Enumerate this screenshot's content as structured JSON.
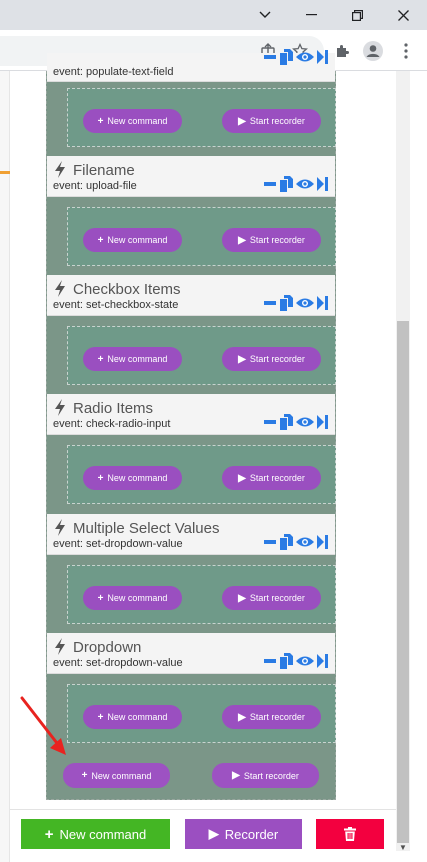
{
  "window": {
    "controls": [
      "chevron-down",
      "minimize",
      "restore",
      "close"
    ]
  },
  "browser_toolbar": {
    "icons": [
      "share-icon",
      "star-icon",
      "extensions-icon",
      "profile-icon",
      "menu-icon"
    ]
  },
  "partial_event": {
    "event": "event: populate-text-field"
  },
  "events": [
    {
      "name": "Filename",
      "event": "event: upload-file"
    },
    {
      "name": "Checkbox Items",
      "event": "event: set-checkbox-state"
    },
    {
      "name": "Radio Items",
      "event": "event: check-radio-input"
    },
    {
      "name": "Multiple Select Values",
      "event": "event: set-dropdown-value"
    },
    {
      "name": "Dropdown",
      "event": "event: set-dropdown-value"
    }
  ],
  "inner": {
    "new_command": "New command",
    "start_recorder": "Start recorder"
  },
  "outer": {
    "new_command": "New command",
    "start_recorder": "Start recorder"
  },
  "bottom": {
    "new_command": "New command",
    "recorder": "Recorder"
  },
  "colors": {
    "purple": "#9a4fc0",
    "green": "#44b624",
    "red": "#f3003f",
    "blue_icons": "#2a7be4",
    "annotation_arrow": "#e8231f"
  }
}
